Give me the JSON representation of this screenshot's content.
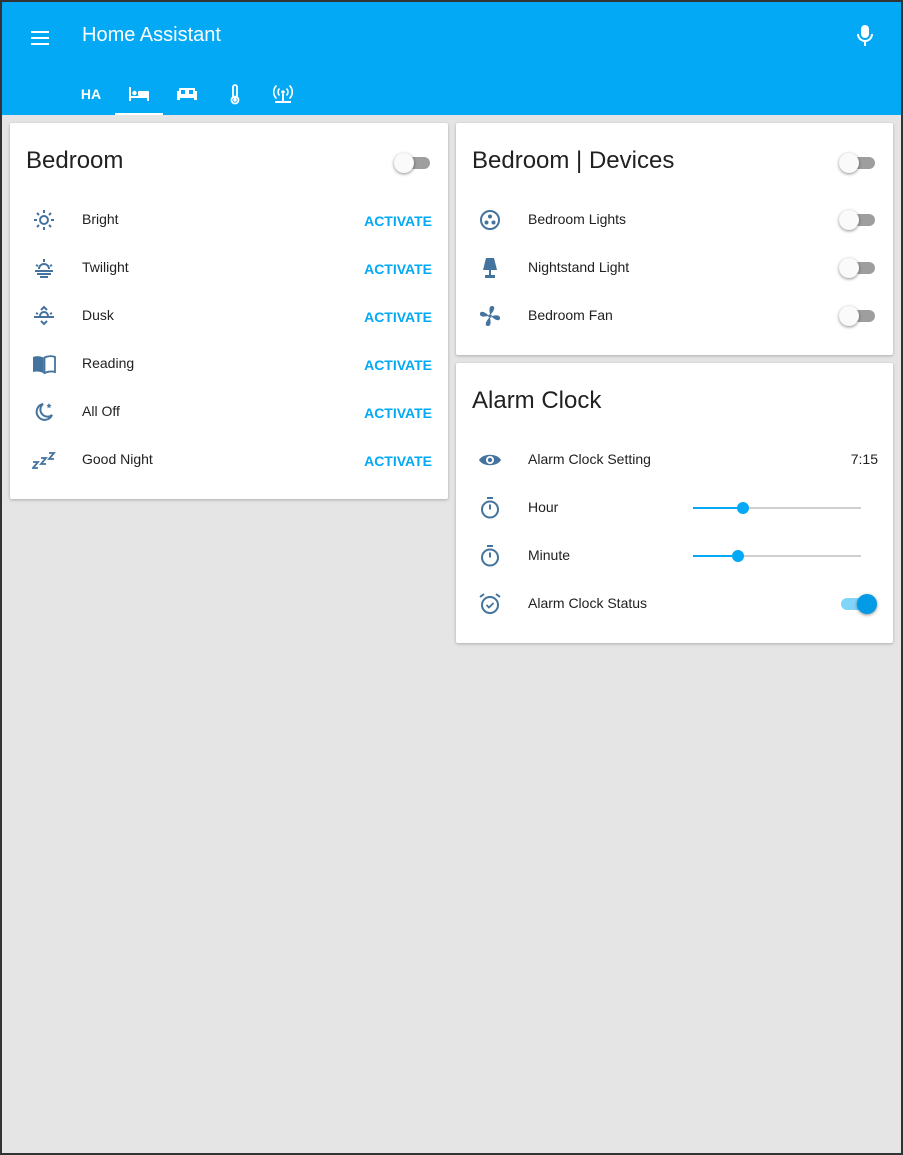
{
  "app": {
    "title": "Home Assistant"
  },
  "tabs": [
    {
      "label": "HA",
      "icon": "home-assistant-text"
    },
    {
      "label": "",
      "icon": "bed-icon",
      "active": true
    },
    {
      "label": "",
      "icon": "sofa-icon"
    },
    {
      "label": "",
      "icon": "thermometer-icon"
    },
    {
      "label": "",
      "icon": "access-point-icon"
    }
  ],
  "bedroom": {
    "title": "Bedroom",
    "toggle_on": false,
    "scenes": [
      {
        "label": "Bright",
        "icon": "brightness-icon",
        "action": "ACTIVATE"
      },
      {
        "label": "Twilight",
        "icon": "weather-sunset-icon",
        "action": "ACTIVATE"
      },
      {
        "label": "Dusk",
        "icon": "weather-sunset-down-icon",
        "action": "ACTIVATE"
      },
      {
        "label": "Reading",
        "icon": "book-open-icon",
        "action": "ACTIVATE"
      },
      {
        "label": "All Off",
        "icon": "weather-night-icon",
        "action": "ACTIVATE"
      },
      {
        "label": "Good Night",
        "icon": "sleep-icon",
        "action": "ACTIVATE"
      }
    ]
  },
  "devices": {
    "title": "Bedroom | Devices",
    "toggle_on": false,
    "items": [
      {
        "label": "Bedroom Lights",
        "icon": "lightbulb-group-icon",
        "on": false
      },
      {
        "label": "Nightstand Light",
        "icon": "lamp-icon",
        "on": false
      },
      {
        "label": "Bedroom Fan",
        "icon": "fan-icon",
        "on": false
      }
    ]
  },
  "alarm": {
    "title": "Alarm Clock",
    "setting_label": "Alarm Clock Setting",
    "setting_value": "7:15",
    "hour_label": "Hour",
    "hour_fraction": 0.3,
    "minute_label": "Minute",
    "minute_fraction": 0.27,
    "status_label": "Alarm Clock Status",
    "status_on": true
  },
  "colors": {
    "header": "#03a9f4",
    "icon": "#44739e",
    "accent": "#03a9f4"
  }
}
